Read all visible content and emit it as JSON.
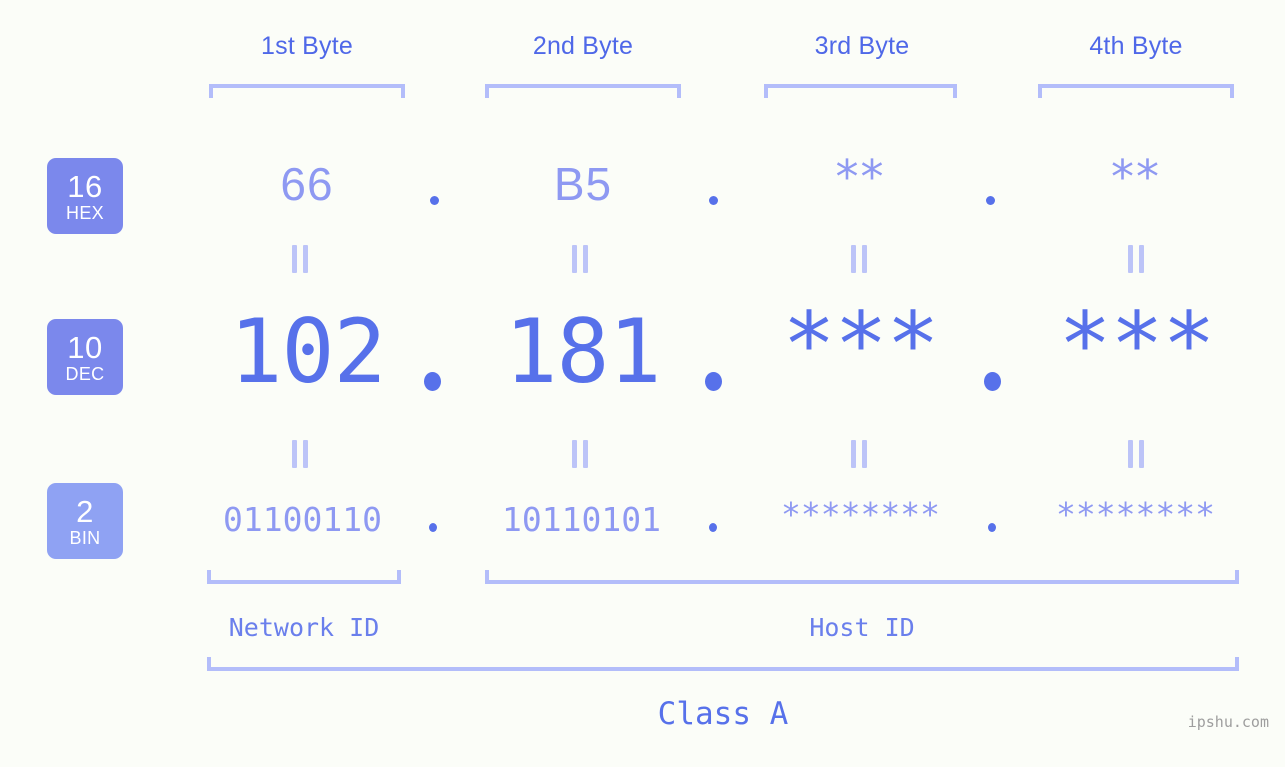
{
  "watermark": "ipshu.com",
  "colors": {
    "background": "#fbfdf8",
    "accent_strong": "#5771ea",
    "accent_mid": "#7b88ec",
    "accent_light": "#8e99f2",
    "bracket": "#b3bdfa",
    "equals": "#bcc4f8",
    "badge_bin": "#8fa2f3",
    "watermark_text": "#9e9e9e"
  },
  "byte_headers": [
    {
      "label": "1st Byte"
    },
    {
      "label": "2nd Byte"
    },
    {
      "label": "3rd Byte"
    },
    {
      "label": "4th Byte"
    }
  ],
  "rows": {
    "hex": {
      "badge_num": "16",
      "badge_name": "HEX",
      "values": [
        "66",
        "B5",
        "**",
        "**"
      ],
      "separator": "."
    },
    "dec": {
      "badge_num": "10",
      "badge_name": "DEC",
      "values": [
        "102",
        "181",
        "***",
        "***"
      ],
      "separator": "."
    },
    "bin": {
      "badge_num": "2",
      "badge_name": "BIN",
      "values": [
        "01100110",
        "10110101",
        "********",
        "********"
      ],
      "separator": "."
    }
  },
  "footer": {
    "network_id_label": "Network ID",
    "host_id_label": "Host ID",
    "class_label": "Class A"
  }
}
